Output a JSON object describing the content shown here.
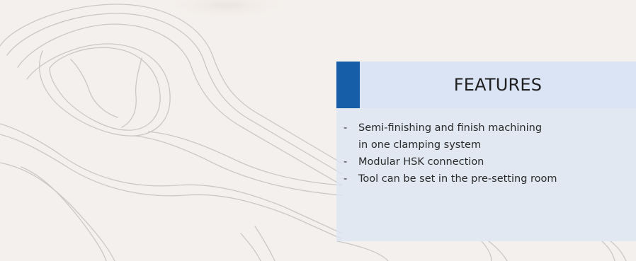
{
  "features": {
    "title": "FEATURES",
    "items": [
      {
        "lines": [
          "Semi-finishing and finish machining",
          "in one clamping system"
        ]
      },
      {
        "lines": [
          "Modular HSK connection"
        ]
      },
      {
        "lines": [
          "Tool can be set in the pre-setting room"
        ]
      }
    ]
  },
  "colors": {
    "background": "#f4f0ed",
    "panel": "#dae4f5",
    "accent": "#175ea8",
    "sketch_lines": "#c9c8c8"
  }
}
